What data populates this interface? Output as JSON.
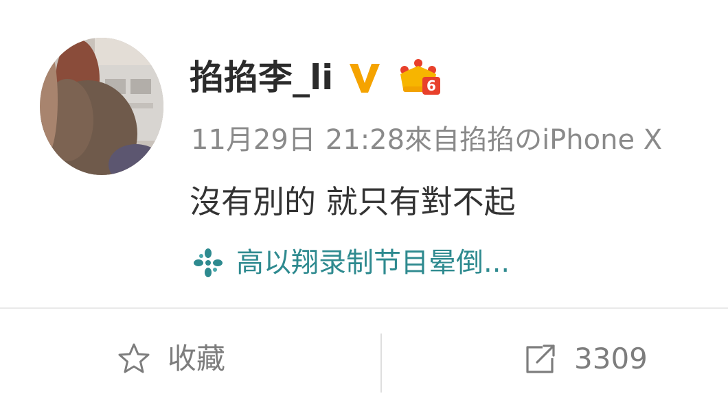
{
  "post": {
    "user": {
      "name": "掐掐李_li",
      "verified_icon": "verified-v-icon",
      "member_badge_icon": "crown-level-badge-icon",
      "member_level": "6"
    },
    "meta": {
      "date": "11月29日",
      "time_source": "21:28來自掐掐のiPhone X"
    },
    "content": "沒有別的 就只有對不起",
    "topic": {
      "icon": "pinwheel-icon",
      "text": "高以翔录制节目晕倒..."
    }
  },
  "actions": {
    "favorite": {
      "icon": "star-outline-icon",
      "label": "收藏"
    },
    "share": {
      "icon": "share-arrow-icon",
      "count": "3309"
    }
  },
  "colors": {
    "username": "#2b2b2b",
    "meta": "#8a8a8a",
    "content": "#333333",
    "topic": "#2e8a8f",
    "verified": "#f5a300",
    "badge_crown": "#f7b500",
    "badge_number_bg": "#e8402b",
    "action_text": "#7d7d7d",
    "divider": "#e9e9e9"
  }
}
